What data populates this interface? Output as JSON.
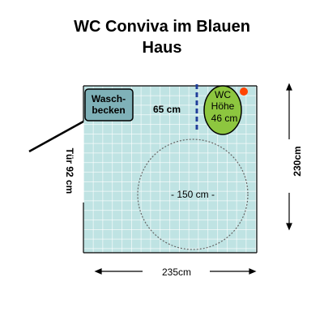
{
  "title": {
    "line1": "WC Conviva im Blauen",
    "line2": "Haus"
  },
  "washbasin": {
    "line1": "Wasch-",
    "line2": "becken"
  },
  "gap_label": "65 cm",
  "toilet": {
    "line1": "WC",
    "line2": "Höhe",
    "line3": "46 cm"
  },
  "turning_circle_label": "- 150 cm -",
  "door_label": "Tür 92 cm",
  "width_label": "235cm",
  "height_label": "230cm",
  "colors": {
    "floor": "#bfe3e3",
    "grid": "#ffffff",
    "washbasin": "#7fb1b8",
    "toilet": "#8dc63f",
    "alarm_button": "#ff4400",
    "dash_line": "#1f3f99"
  }
}
